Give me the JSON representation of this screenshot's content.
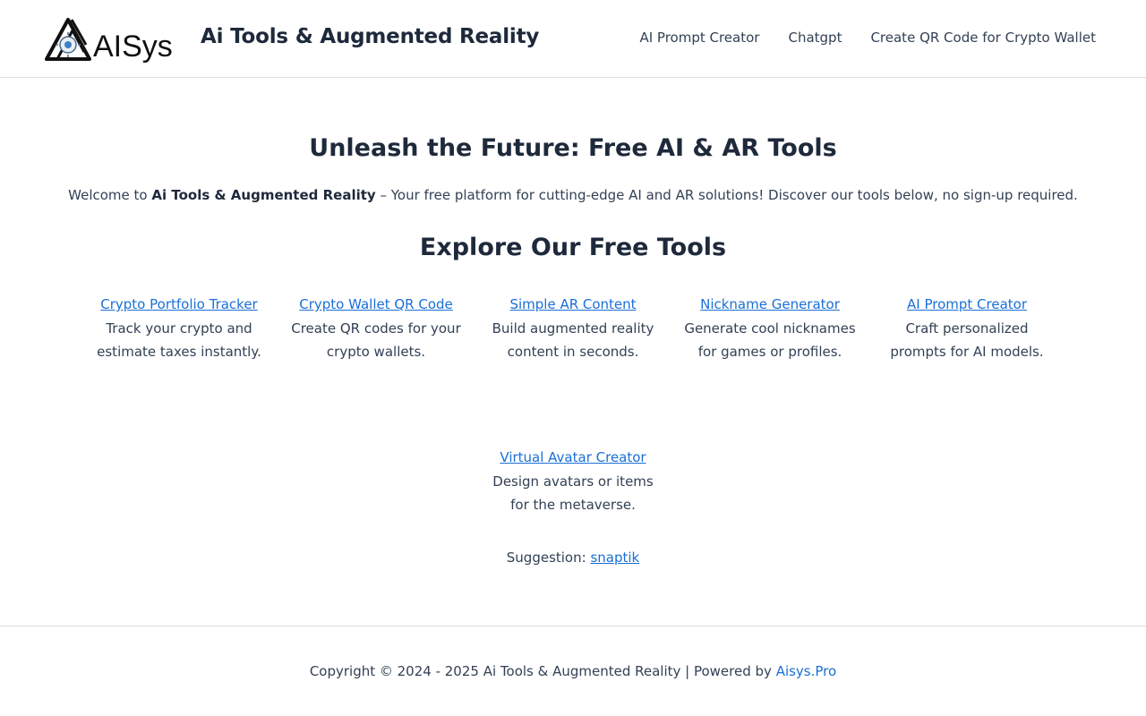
{
  "header": {
    "logo_text": "AISys",
    "site_title": "Ai Tools & Augmented Reality",
    "nav": [
      {
        "label": "AI Prompt Creator"
      },
      {
        "label": "Chatgpt"
      },
      {
        "label": "Create QR Code for Crypto Wallet"
      }
    ]
  },
  "hero": {
    "title": "Unleash the Future: Free AI & AR Tools",
    "intro_prefix": "Welcome to ",
    "intro_strong": "Ai Tools & Augmented Reality",
    "intro_suffix": " – Your free platform for cutting-edge AI and AR solutions! Discover our tools below, no sign-up required."
  },
  "tools_section": {
    "title": "Explore Our Free Tools",
    "tools": [
      {
        "name": "Crypto Portfolio Tracker",
        "description": "Track your crypto and estimate taxes instantly."
      },
      {
        "name": "Crypto Wallet QR Code",
        "description": "Create QR codes for your crypto wallets."
      },
      {
        "name": "Simple AR Content",
        "description": "Build augmented reality content in seconds."
      },
      {
        "name": "Nickname Generator",
        "description": "Generate cool nicknames for games or profiles."
      },
      {
        "name": "AI Prompt Creator",
        "description": "Craft personalized prompts for AI models."
      },
      {
        "name": "Virtual Avatar Creator",
        "description": "Design avatars or items for the metaverse."
      }
    ]
  },
  "suggestion": {
    "label": "Suggestion: ",
    "link": "snaptik"
  },
  "footer": {
    "copyright": "Copyright © 2024 - 2025 Ai Tools & Augmented Reality | Powered by ",
    "powered_link": "Aisys.Pro"
  },
  "colors": {
    "link": "#1a6fd6",
    "heading": "#1e293b",
    "text": "#334155",
    "border": "#dcdfe3"
  }
}
